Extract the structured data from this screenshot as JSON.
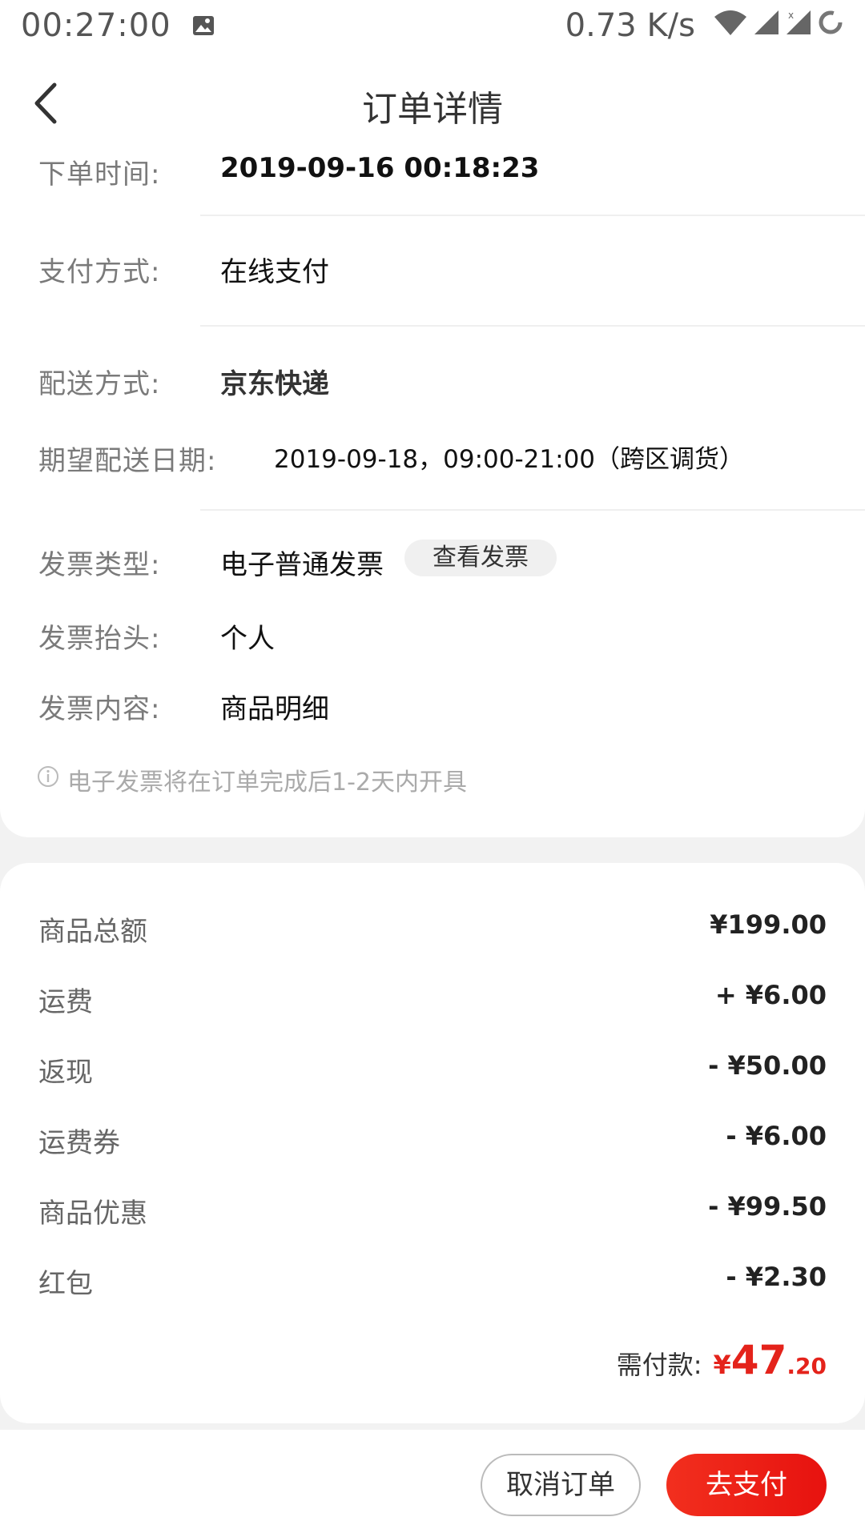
{
  "status_bar": {
    "time": "00:27:00",
    "net_speed": "0.73 K/s",
    "icons": [
      "image-icon",
      "wifi-icon",
      "signal-icon",
      "signal-x-icon",
      "loading-ring-icon"
    ]
  },
  "header": {
    "title": "订单详情",
    "back_icon": "back-arrow-icon"
  },
  "order_info": {
    "order_time_label": "下单时间:",
    "order_time_value": "2019-09-16 00:18:23",
    "pay_method_label": "支付方式:",
    "pay_method_value": "在线支付",
    "delivery_label": "配送方式:",
    "delivery_value": "京东快递",
    "expected_label": "期望配送日期:",
    "expected_value": "2019-09-18，09:00-21:00（跨区调货）",
    "invoice_type_label": "发票类型:",
    "invoice_type_value": "电子普通发票",
    "view_invoice_label": "查看发票",
    "invoice_title_label": "发票抬头:",
    "invoice_title_value": "个人",
    "invoice_content_label": "发票内容:",
    "invoice_content_value": "商品明细",
    "notice": "电子发票将在订单完成后1-2天内开具"
  },
  "fees": [
    {
      "label": "商品总额",
      "amount": "¥199.00"
    },
    {
      "label": "运费",
      "amount": "+ ¥6.00"
    },
    {
      "label": "返现",
      "amount": "- ¥50.00"
    },
    {
      "label": "运费券",
      "amount": "- ¥6.00"
    },
    {
      "label": "商品优惠",
      "amount": "- ¥99.50"
    },
    {
      "label": "红包",
      "amount": "- ¥2.30"
    }
  ],
  "total": {
    "label": "需付款:",
    "currency": "¥",
    "integer": "47",
    "decimal": ".20"
  },
  "actions": {
    "cancel_label": "取消订单",
    "pay_label": "去支付"
  },
  "colors": {
    "accent": "#e4231b",
    "background": "#f2f2f2"
  }
}
